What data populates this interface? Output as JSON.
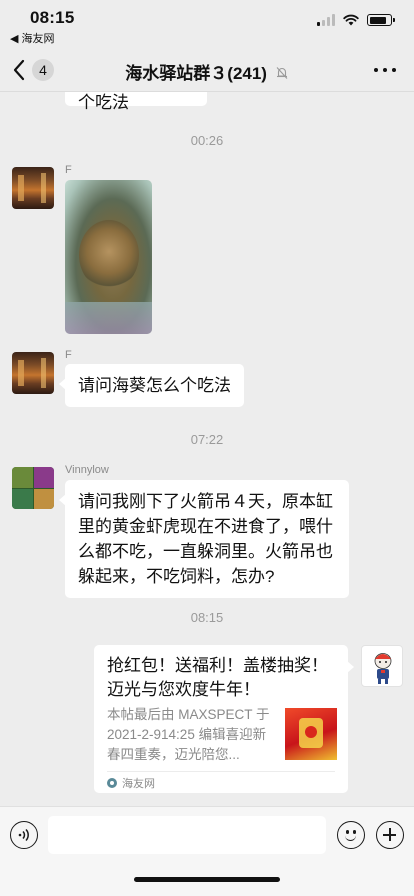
{
  "status_bar": {
    "time": "08:15",
    "back_app": "◀ 海友网",
    "icons": [
      "signal-icon",
      "wifi-icon",
      "battery-icon"
    ]
  },
  "nav": {
    "unread_count": "4",
    "title": "海水驿站群３(241)",
    "icons": [
      "back-chevron-icon",
      "mute-bell-icon",
      "more-icon"
    ]
  },
  "chat": {
    "partial_bubble_text": "请问海葵怎么个吃法",
    "messages": [
      {
        "type": "timestamp",
        "text": "00:26"
      },
      {
        "type": "image",
        "sender": "F",
        "description_icon": "photo-icon"
      },
      {
        "type": "text",
        "sender": "F",
        "text": "请问海葵怎么个吃法"
      },
      {
        "type": "timestamp",
        "text": "07:22"
      },
      {
        "type": "text",
        "sender": "Vinnylow",
        "text": "请问我刚下了火箭吊４天，原本缸里的黄金虾虎现在不进食了，喂什么都不吃，一直躲洞里。火箭吊也躲起来，不吃饲料，怎办?"
      },
      {
        "type": "timestamp",
        "text": "08:15"
      },
      {
        "type": "link_card",
        "title": "抢红包！送福利！盖楼抽奖！迈光与您欢度牛年！",
        "description": "本帖最后由 MAXSPECT 于 2021-2-914:25 编辑喜迎新春四重奏，迈光陪您...",
        "source": "海友网"
      }
    ]
  },
  "input_bar": {
    "placeholder": "",
    "icons": [
      "voice-icon",
      "emoji-icon",
      "plus-icon"
    ]
  },
  "colors": {
    "background": "#ededed",
    "bubble": "#ffffff",
    "timestamp": "#9a9a9a",
    "sender": "#8a8a8a"
  }
}
